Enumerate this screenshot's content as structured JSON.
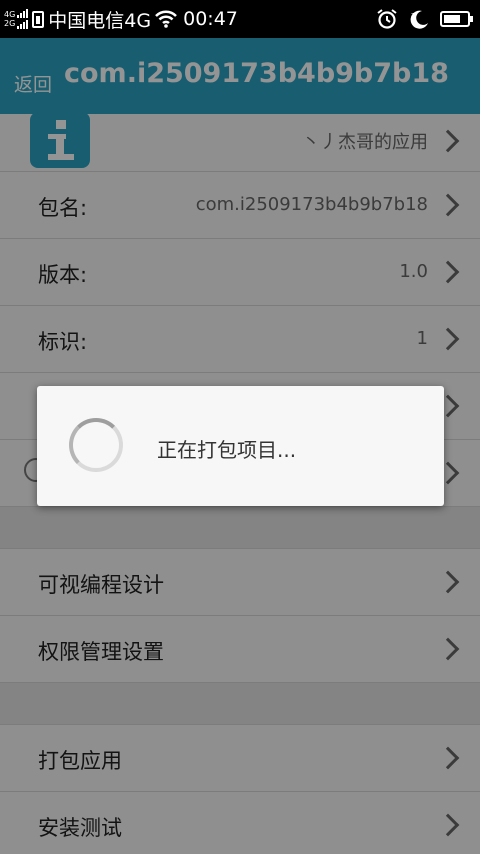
{
  "status_bar": {
    "network_tag_top": "4G",
    "network_tag_bottom": "2G",
    "carrier": "中国电信4G",
    "time": "00:47",
    "icons": [
      "signal-icon",
      "sim-icon",
      "wifi-icon",
      "alarm-icon",
      "night-mode-icon",
      "battery-icon"
    ]
  },
  "toolbar": {
    "back_label": "返回",
    "title": "com.i2509173b4b9b7b18"
  },
  "list": {
    "header_row": {
      "value": "丶丿杰哥的应用"
    },
    "info_rows": [
      {
        "label": "包名:",
        "value": "com.i2509173b4b9b7b18"
      },
      {
        "label": "版本:",
        "value": "1.0"
      },
      {
        "label": "标识:",
        "value": "1"
      }
    ],
    "design_rows": [
      {
        "label": "可视编程设计"
      },
      {
        "label": "权限管理设置"
      }
    ],
    "action_rows": [
      {
        "label": "打包应用"
      },
      {
        "label": "安装测试"
      }
    ]
  },
  "dialog": {
    "message": "正在打包项目..."
  },
  "colors": {
    "accent": "#2aa3c2",
    "status_bar": "#000000",
    "dialog_bg": "#f7f7f7"
  }
}
